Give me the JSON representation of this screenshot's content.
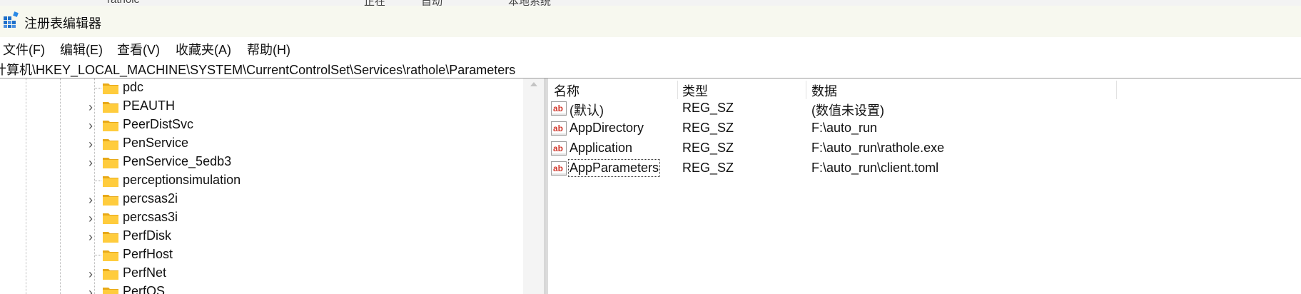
{
  "background_window": {
    "items": [
      "rathole",
      "正在",
      "自动",
      "本地系统"
    ]
  },
  "window": {
    "title": "注册表编辑器",
    "accent_color": "#1e6fc9"
  },
  "menu": [
    "文件(F)",
    "编辑(E)",
    "查看(V)",
    "收藏夹(A)",
    "帮助(H)"
  ],
  "address": "计算机\\HKEY_LOCAL_MACHINE\\SYSTEM\\CurrentControlSet\\Services\\rathole\\Parameters",
  "tree": [
    {
      "label": "pdc",
      "expandable": false
    },
    {
      "label": "PEAUTH",
      "expandable": true
    },
    {
      "label": "PeerDistSvc",
      "expandable": true
    },
    {
      "label": "PenService",
      "expandable": true
    },
    {
      "label": "PenService_5edb3",
      "expandable": true
    },
    {
      "label": "perceptionsimulation",
      "expandable": false
    },
    {
      "label": "percsas2i",
      "expandable": true
    },
    {
      "label": "percsas3i",
      "expandable": true
    },
    {
      "label": "PerfDisk",
      "expandable": true
    },
    {
      "label": "PerfHost",
      "expandable": false
    },
    {
      "label": "PerfNet",
      "expandable": true
    },
    {
      "label": "PerfOS",
      "expandable": true
    }
  ],
  "list": {
    "columns": [
      "名称",
      "类型",
      "数据"
    ],
    "rows": [
      {
        "name": "(默认)",
        "type": "REG_SZ",
        "data": "(数值未设置)"
      },
      {
        "name": "AppDirectory",
        "type": "REG_SZ",
        "data": "F:\\auto_run"
      },
      {
        "name": "Application",
        "type": "REG_SZ",
        "data": "F:\\auto_run\\rathole.exe"
      },
      {
        "name": "AppParameters",
        "type": "REG_SZ",
        "data": "F:\\auto_run\\client.toml",
        "focused": true
      }
    ]
  },
  "icons": {
    "app": "registry-editor-icon",
    "folder": "folder-icon",
    "string_value": "string-value-icon",
    "expand": "chevron-right-icon"
  }
}
